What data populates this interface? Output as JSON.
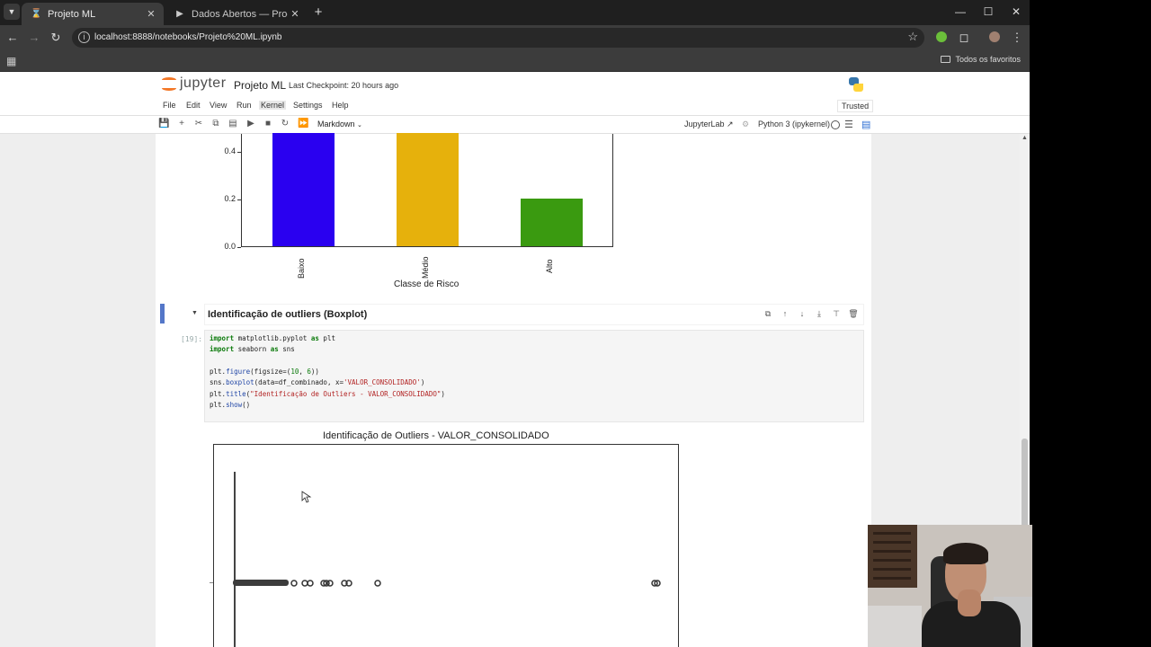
{
  "browser": {
    "tabs": [
      {
        "title": "Projeto ML",
        "active": true,
        "favicon": "jupyter-hourglass-icon"
      },
      {
        "title": "Dados Abertos — Procuradoria",
        "active": false,
        "favicon": "gov-icon"
      }
    ],
    "url": "localhost:8888/notebooks/Projeto%20ML.ipynb",
    "bookmarks_label": "Todos os favoritos"
  },
  "jupyter": {
    "logo_text": "jupyter",
    "notebook_name": "Projeto ML",
    "checkpoint": "Last Checkpoint: 20 hours ago",
    "menu": [
      "File",
      "Edit",
      "View",
      "Run",
      "Kernel",
      "Settings",
      "Help"
    ],
    "trusted": "Trusted",
    "cell_type": "Markdown",
    "jupyterlab_link": "JupyterLab",
    "kernel_name": "Python 3 (ipykernel)"
  },
  "bar_chart": {
    "ytick_labels": [
      "0.4",
      "0.2",
      "0.0"
    ],
    "xlabel": "Classe de Risco"
  },
  "chart_data": {
    "type": "bar",
    "categories": [
      "Baixo",
      "Médio",
      "Alto"
    ],
    "values": [
      0.5,
      0.5,
      0.2
    ],
    "colors": [
      "#2a00f0",
      "#e6b10c",
      "#3a9a10"
    ],
    "xlabel": "Classe de Risco",
    "ylabel": "",
    "ylim": [
      0,
      0.47
    ]
  },
  "markdown_cell": {
    "heading": "Identificação de outliers (Boxplot)"
  },
  "code_cell": {
    "prompt": "[19]:",
    "lines": [
      [
        {
          "t": "import",
          "c": "kw"
        },
        {
          "t": " matplotlib.pyplot ",
          "c": ""
        },
        {
          "t": "as",
          "c": "kw"
        },
        {
          "t": " plt",
          "c": ""
        }
      ],
      [
        {
          "t": "import",
          "c": "kw"
        },
        {
          "t": " seaborn ",
          "c": ""
        },
        {
          "t": "as",
          "c": "kw"
        },
        {
          "t": " sns",
          "c": ""
        }
      ],
      [],
      [
        {
          "t": "plt",
          "c": ""
        },
        {
          "t": ".",
          "c": ""
        },
        {
          "t": "figure",
          "c": "fn"
        },
        {
          "t": "(figsize=(",
          "c": ""
        },
        {
          "t": "10",
          "c": "num"
        },
        {
          "t": ", ",
          "c": ""
        },
        {
          "t": "6",
          "c": "num"
        },
        {
          "t": "))",
          "c": ""
        }
      ],
      [
        {
          "t": "sns",
          "c": ""
        },
        {
          "t": ".",
          "c": ""
        },
        {
          "t": "boxplot",
          "c": "fn"
        },
        {
          "t": "(data=df_combinado, x=",
          "c": ""
        },
        {
          "t": "'VALOR_CONSOLIDADO'",
          "c": "str"
        },
        {
          "t": ")",
          "c": ""
        }
      ],
      [
        {
          "t": "plt",
          "c": ""
        },
        {
          "t": ".",
          "c": ""
        },
        {
          "t": "title",
          "c": "fn"
        },
        {
          "t": "(",
          "c": ""
        },
        {
          "t": "\"Identificação de Outliers - VALOR_CONSOLIDADO\"",
          "c": "str"
        },
        {
          "t": ")",
          "c": ""
        }
      ],
      [
        {
          "t": "plt",
          "c": ""
        },
        {
          "t": ".",
          "c": ""
        },
        {
          "t": "show",
          "c": "fn"
        },
        {
          "t": "()",
          "c": ""
        }
      ]
    ]
  },
  "boxplot": {
    "title": "Identificação de Outliers - VALOR_CONSOLIDADO"
  }
}
